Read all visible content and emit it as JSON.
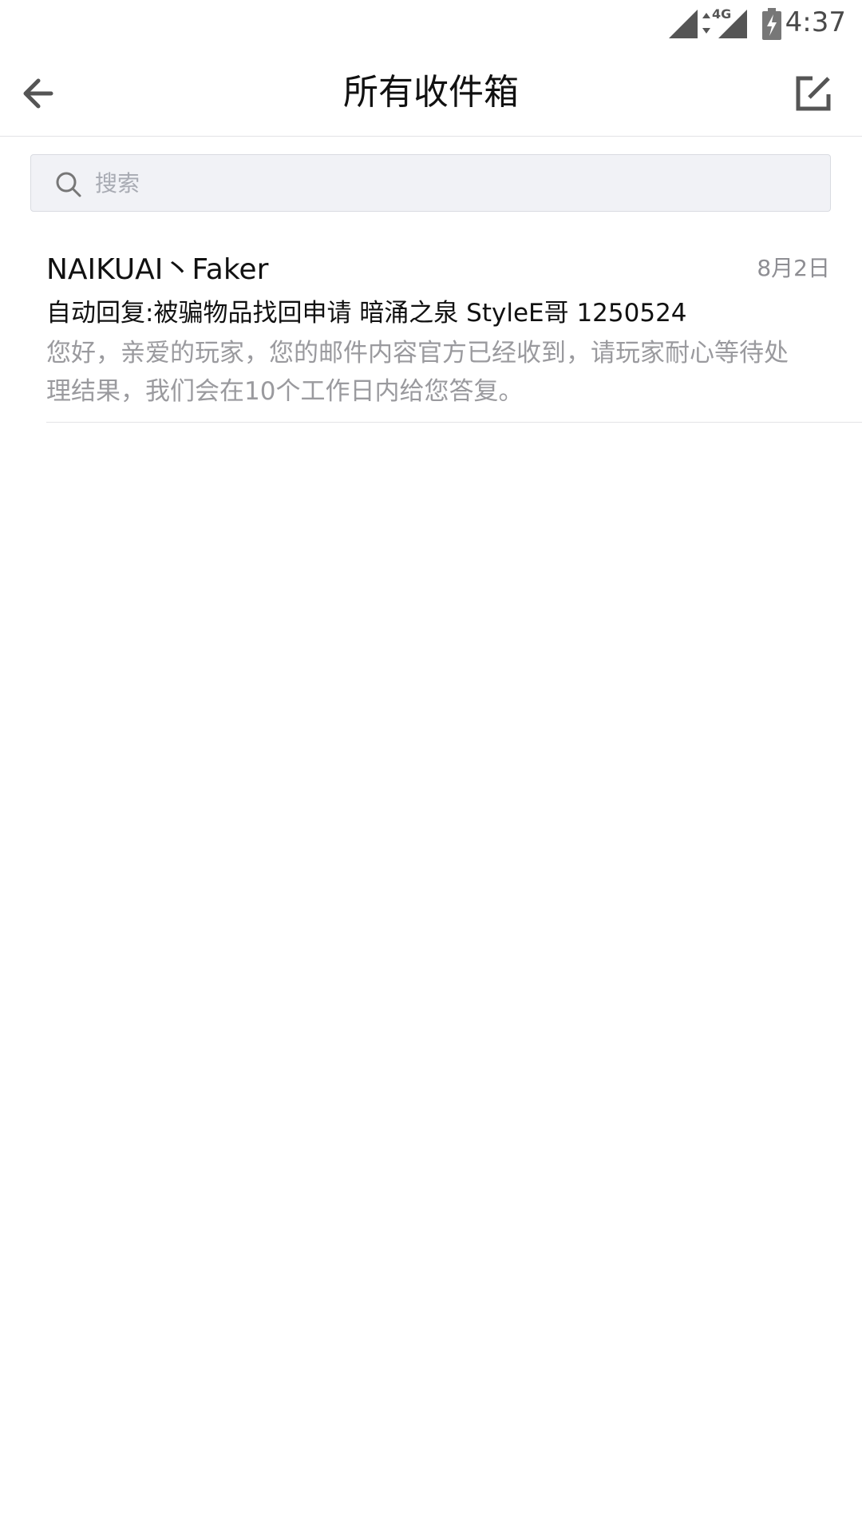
{
  "status_bar": {
    "network": "4G",
    "time": "4:37",
    "icons": [
      "signal-icon",
      "data-arrows-icon",
      "signal-icon",
      "battery-charging-icon"
    ]
  },
  "header": {
    "title": "所有收件箱",
    "back_icon": "arrow-left-icon",
    "compose_icon": "compose-icon"
  },
  "search": {
    "placeholder": "搜索",
    "value": "",
    "icon": "search-icon"
  },
  "mail_list": [
    {
      "sender": "NAIKUAI丶Faker",
      "date": "8月2日",
      "subject": "自动回复:被骗物品找回申请 暗涌之泉 StyleE哥 1250524",
      "preview": "您好，亲爱的玩家，您的邮件内容官方已经收到，请玩家耐心等待处理结果，我们会在10个工作日内给您答复。"
    }
  ],
  "colors": {
    "title_text": "#111111",
    "secondary_text": "#9a9a9e",
    "search_bg": "#f1f2f6",
    "divider": "#e3e3e6",
    "icon": "#555555"
  }
}
